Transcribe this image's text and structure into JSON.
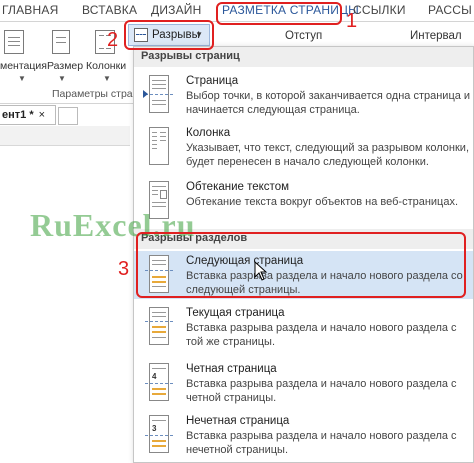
{
  "tabs": [
    {
      "label": "ГЛАВНАЯ"
    },
    {
      "label": "ВСТАВКА"
    },
    {
      "label": "ДИЗАЙН"
    },
    {
      "label": "РАЗМЕТКА СТРАНИЦЫ"
    },
    {
      "label": "ССЫЛКИ"
    },
    {
      "label": "РАССЫ"
    }
  ],
  "ribbon": {
    "orientation_label": "ментация",
    "size_label": "Размер",
    "columns_label": "Колонки",
    "group_label": "Параметры стра",
    "breaks_label": "Разрывы",
    "indent_label": "Отступ",
    "interval_label": "Интервал"
  },
  "document": {
    "tab_label": "ент1 *",
    "close_glyph": "×"
  },
  "menu": {
    "page_breaks_header": "Разрывы страниц",
    "section_breaks_header": "Разрывы разделов",
    "items": [
      {
        "title": "Страница",
        "desc": "Выбор точки, в которой заканчивается одна страница и начинается следующая страница."
      },
      {
        "title": "Колонка",
        "desc": "Указывает, что текст, следующий за разрывом колонки, будет перенесен в начало следующей колонки."
      },
      {
        "title": "Обтекание текстом",
        "desc": "Обтекание текста вокруг объектов на веб-страницах."
      },
      {
        "title": "Следующая страница",
        "desc": "Вставка разрыва раздела и начало нового раздела со следующей страницы."
      },
      {
        "title": "Текущая страница",
        "desc": "Вставка разрыва раздела и начало нового раздела с той же страницы."
      },
      {
        "title": "Четная страница",
        "desc": "Вставка разрыва раздела и начало нового раздела с четной страницы."
      },
      {
        "title": "Нечетная страница",
        "desc": "Вставка разрыва раздела и начало нового раздела с нечетной страницы."
      }
    ]
  },
  "annotations": {
    "step1": "1",
    "step2": "2",
    "step3": "3"
  },
  "watermark": "RuExcel.ru",
  "colors": {
    "accent": "#2b579a",
    "highlight": "#d5e4f5",
    "annotation": "#e02020"
  }
}
